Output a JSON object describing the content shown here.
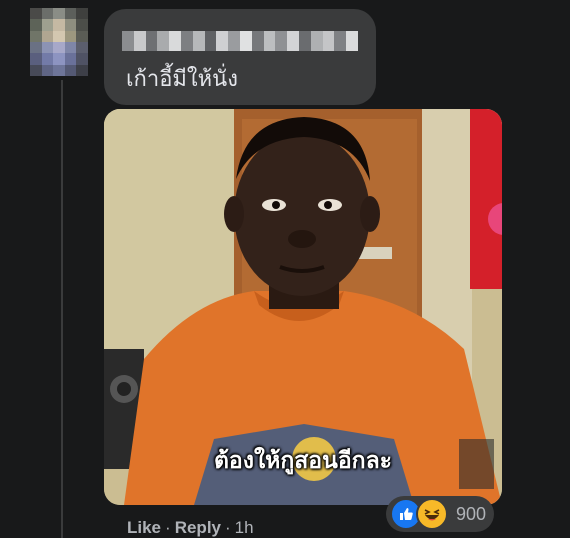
{
  "comment": {
    "text": "เก้าอี้มีให้นั่ง"
  },
  "image": {
    "caption": "ต้องให้กูสอนอีกละ"
  },
  "actions": {
    "like_label": "Like",
    "reply_label": "Reply",
    "separator": "·",
    "time": "1h"
  },
  "reactions": {
    "count": "900",
    "icons": [
      "like-icon",
      "haha-icon"
    ]
  }
}
